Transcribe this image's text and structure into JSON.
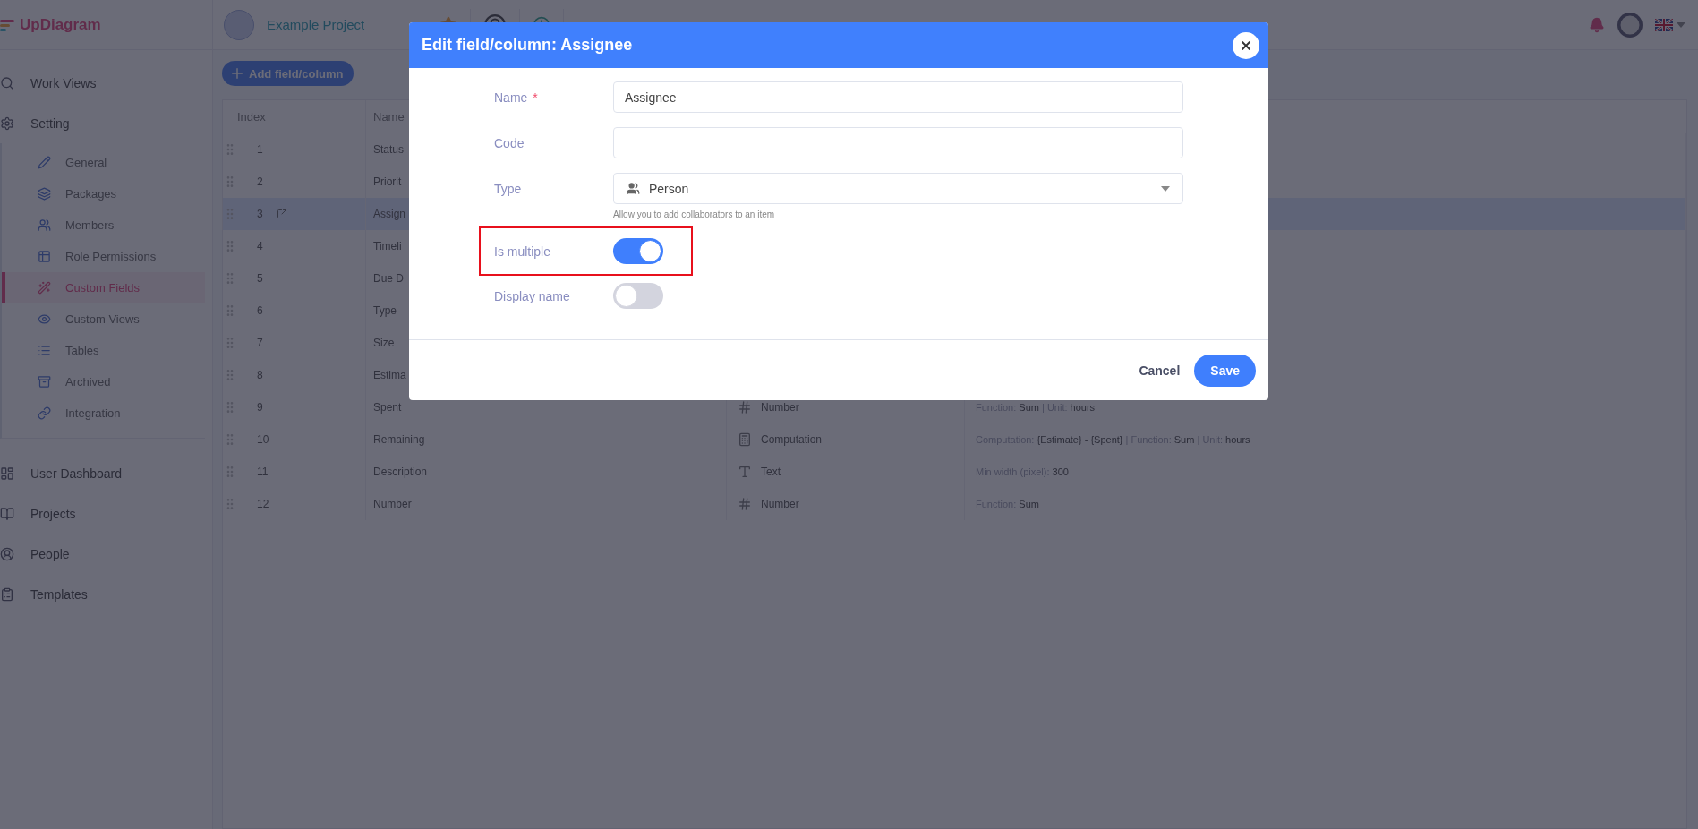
{
  "app": {
    "logo": "UpDiagram",
    "project": "Example Project"
  },
  "sidebar": {
    "items": [
      {
        "label": "Work Views",
        "selected": false
      },
      {
        "label": "Setting",
        "selected": false,
        "children": [
          {
            "label": "General",
            "selected": false
          },
          {
            "label": "Packages",
            "selected": false
          },
          {
            "label": "Members",
            "selected": false
          },
          {
            "label": "Role Permissions",
            "selected": false
          },
          {
            "label": "Custom Fields",
            "selected": true
          },
          {
            "label": "Custom Views",
            "selected": false
          },
          {
            "label": "Tables",
            "selected": false
          },
          {
            "label": "Archived",
            "selected": false
          },
          {
            "label": "Integration",
            "selected": false
          }
        ]
      },
      {
        "label": "User Dashboard",
        "selected": false
      },
      {
        "label": "Projects",
        "selected": false
      },
      {
        "label": "People",
        "selected": false
      },
      {
        "label": "Templates",
        "selected": false
      }
    ]
  },
  "toolbar": {
    "add_button": "Add field/column"
  },
  "table": {
    "columns": [
      "Index",
      "Name"
    ],
    "rows": [
      {
        "index": "1",
        "name": "Status",
        "selected": false
      },
      {
        "index": "2",
        "name": "Priorit",
        "selected": false
      },
      {
        "index": "3",
        "name": "Assign",
        "selected": true
      },
      {
        "index": "4",
        "name": "Timeli",
        "selected": false
      },
      {
        "index": "5",
        "name": "Due D",
        "selected": false
      },
      {
        "index": "6",
        "name": "Type",
        "selected": false
      },
      {
        "index": "7",
        "name": "Size",
        "selected": false
      },
      {
        "index": "8",
        "name": "Estima",
        "selected": false
      },
      {
        "index": "9",
        "name": "Spent",
        "selected": false,
        "type": {
          "kind": "number",
          "label": "Number"
        },
        "details": [
          {
            "kind": "label",
            "text": "Function: "
          },
          {
            "kind": "value",
            "text": "Sum"
          },
          {
            "kind": "label",
            "text": " | Unit: "
          },
          {
            "kind": "value",
            "text": "hours"
          }
        ]
      },
      {
        "index": "10",
        "name": "Remaining",
        "selected": false,
        "type": {
          "kind": "computation",
          "label": "Computation"
        },
        "details": [
          {
            "kind": "label",
            "text": "Computation: "
          },
          {
            "kind": "value",
            "text": "{Estimate} - {Spent}"
          },
          {
            "kind": "label",
            "text": " | Function: "
          },
          {
            "kind": "value",
            "text": "Sum"
          },
          {
            "kind": "label",
            "text": " | Unit: "
          },
          {
            "kind": "value",
            "text": "hours"
          }
        ]
      },
      {
        "index": "11",
        "name": "Description",
        "selected": false,
        "type": {
          "kind": "text",
          "label": "Text"
        },
        "details": [
          {
            "kind": "label",
            "text": "Min width (pixel): "
          },
          {
            "kind": "value",
            "text": "300"
          }
        ]
      },
      {
        "index": "12",
        "name": "Number",
        "selected": false,
        "type": {
          "kind": "number",
          "label": "Number"
        },
        "details": [
          {
            "kind": "label",
            "text": "Function: "
          },
          {
            "kind": "value",
            "text": "Sum"
          }
        ]
      }
    ]
  },
  "modal": {
    "title": "Edit field/column: Assignee",
    "fields": [
      {
        "kind": "text",
        "label": "Name",
        "required_mark": "*",
        "value": "Assignee"
      },
      {
        "kind": "text",
        "label": "Code"
      },
      {
        "kind": "select",
        "label": "Type",
        "value": "Person",
        "hint": "Allow you to add collaborators to an item"
      },
      {
        "kind": "switch",
        "label": "Is multiple",
        "on": true,
        "highlighted": true
      },
      {
        "kind": "switch",
        "label": "Display name",
        "on": false,
        "highlighted": false
      }
    ],
    "buttons": [
      {
        "kind": "secondary",
        "label": "Cancel"
      },
      {
        "kind": "primary",
        "label": "Save"
      }
    ]
  }
}
